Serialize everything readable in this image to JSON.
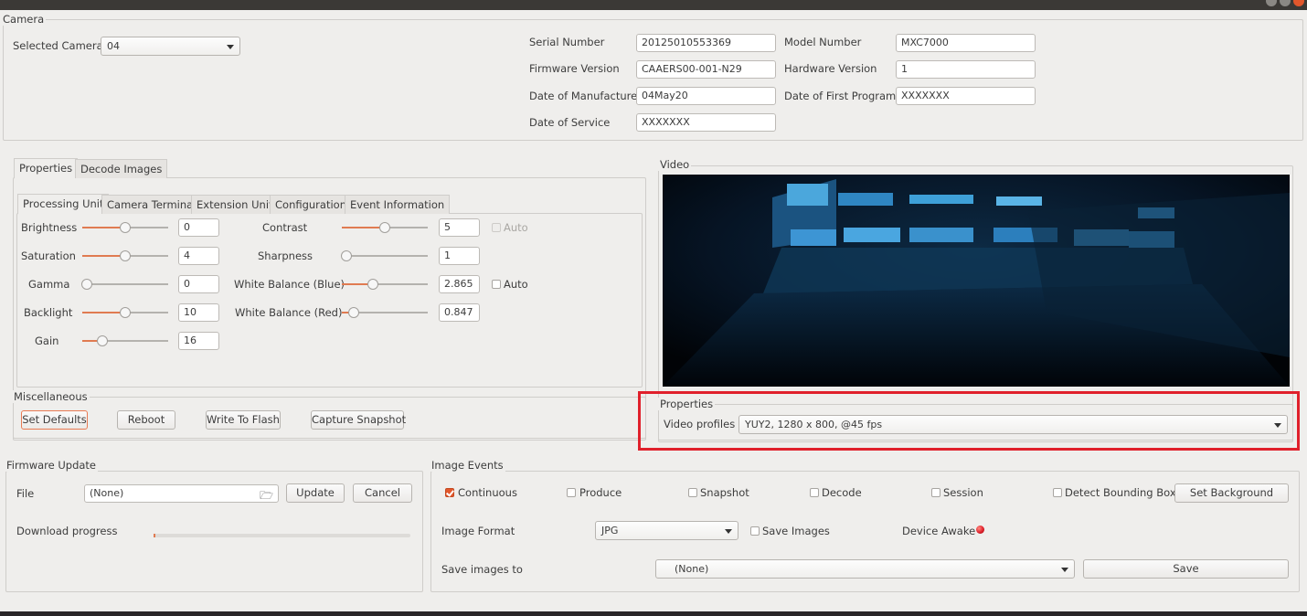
{
  "camera_group": {
    "title": "Camera",
    "selected_camera_label": "Selected Camera",
    "selected_camera_value": "04",
    "serial_number_label": "Serial Number",
    "serial_number_value": "20125010553369",
    "model_number_label": "Model Number",
    "model_number_value": "MXC7000",
    "firmware_version_label": "Firmware Version",
    "firmware_version_value": "CAAERS00-001-N29",
    "hardware_version_label": "Hardware Version",
    "hardware_version_value": "1",
    "date_of_manufacture_label": "Date of Manufacture",
    "date_of_manufacture_value": "04May20",
    "date_of_first_program_label": "Date of First Program",
    "date_of_first_program_value": "XXXXXXX",
    "date_of_service_label": "Date of Service",
    "date_of_service_value": "XXXXXXX"
  },
  "main_tabs": [
    "Properties",
    "Decode Images"
  ],
  "sub_tabs": [
    "Processing Unit",
    "Camera Terminal",
    "Extension Unit",
    "Configuration",
    "Event Information"
  ],
  "processing": {
    "left": [
      {
        "label": "Brightness",
        "value": "0",
        "level": 0.5
      },
      {
        "label": "Saturation",
        "value": "4",
        "level": 0.5
      },
      {
        "label": "Gamma",
        "value": "0",
        "level": 0.0
      },
      {
        "label": "Backlight",
        "value": "10",
        "level": 0.5
      },
      {
        "label": "Gain",
        "value": "16",
        "level": 0.2
      }
    ],
    "right": [
      {
        "label": "Contrast",
        "value": "5",
        "level": 0.5
      },
      {
        "label": "Sharpness",
        "value": "1",
        "level": 0.0
      },
      {
        "label": "White Balance (Blue)",
        "value": "2.865",
        "level": 0.35
      },
      {
        "label": "White Balance (Red)",
        "value": "0.847",
        "level": 0.1
      }
    ],
    "auto_label": "Auto"
  },
  "misc": {
    "title": "Miscellaneous",
    "set_defaults": "Set Defaults",
    "reboot": "Reboot",
    "write_to_flash": "Write To Flash",
    "capture_snapshot": "Capture Snapshot"
  },
  "video": {
    "title": "Video",
    "properties_title": "Properties",
    "video_profiles_label": "Video profiles",
    "video_profiles_value": "YUY2, 1280 x 800, @45 fps"
  },
  "firmware": {
    "title": "Firmware Update",
    "file_label": "File",
    "file_value": "(None)",
    "update_button": "Update",
    "cancel_button": "Cancel",
    "download_progress_label": "Download progress",
    "progress": 0.0
  },
  "image_events": {
    "title": "Image Events",
    "checkboxes": [
      {
        "label": "Continuous",
        "checked": true
      },
      {
        "label": "Produce",
        "checked": false
      },
      {
        "label": "Snapshot",
        "checked": false
      },
      {
        "label": "Decode",
        "checked": false
      },
      {
        "label": "Session",
        "checked": false
      },
      {
        "label": "Detect Bounding Box",
        "checked": false
      }
    ],
    "set_background_button": "Set Background",
    "image_format_label": "Image Format",
    "image_format_value": "JPG",
    "save_images_label": "Save Images",
    "device_awake_label": "Device Awake",
    "device_awake_color": "#e0202b",
    "save_images_to_label": "Save images to",
    "save_images_to_value": "(None)",
    "save_button": "Save"
  },
  "colors": {
    "accent": "#e07b51",
    "highlight_box": "#e0202b"
  }
}
